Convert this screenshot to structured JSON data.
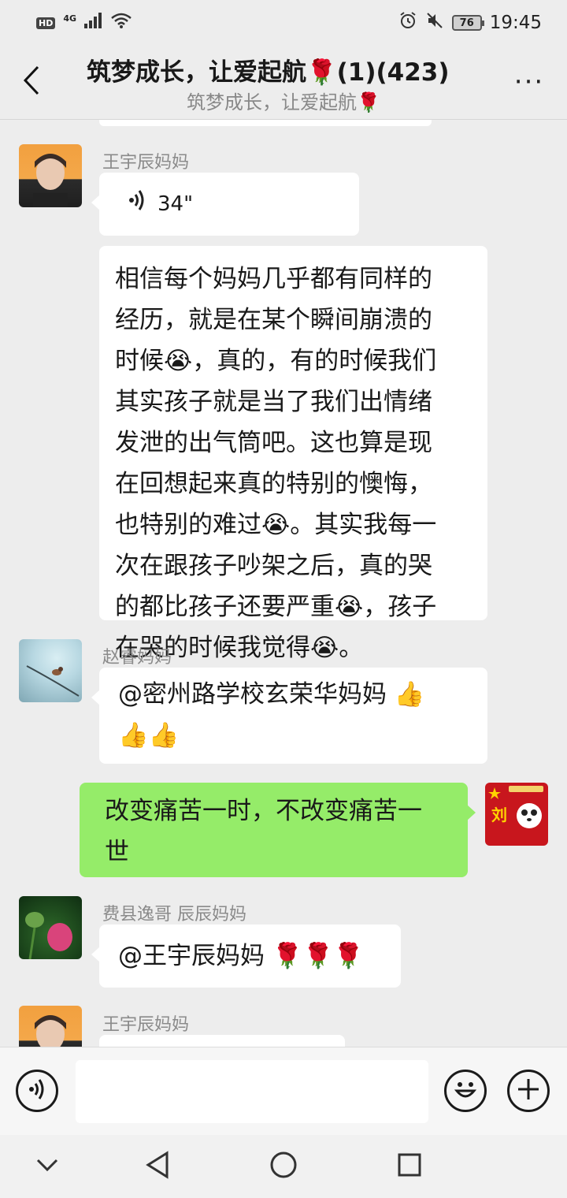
{
  "status_bar": {
    "hd": "HD",
    "network": "4G",
    "battery": "76",
    "time": "19:45"
  },
  "header": {
    "title": "筑梦成长，让爱起航🌹(1)(423)",
    "subtitle": "筑梦成长，让爱起航🌹",
    "more": "···"
  },
  "messages": [
    {
      "sender": "王宇辰妈妈",
      "type": "voice",
      "duration": "34\""
    },
    {
      "sender": "王宇辰妈妈",
      "type": "text",
      "lines": [
        "相信每个妈妈几乎都有同样的",
        "经历，就是在某个瞬间崩溃的",
        "时候😭，真的，有的时候我们",
        "其实孩子就是当了我们出情绪",
        "发泄的出气筒吧。这也算是现",
        "在回想起来真的特别的懊悔，",
        "也特别的难过😭。其实我每一",
        "次在跟孩子吵架之后，真的哭",
        "的都比孩子还要严重😭，孩子",
        "在哭的时候我觉得😭。"
      ]
    },
    {
      "sender": "赵睿妈妈",
      "type": "text",
      "lines": [
        "@密州路学校玄荣华妈妈 👍",
        "👍👍"
      ]
    },
    {
      "sender": "me",
      "type": "text",
      "lines": [
        "改变痛苦一时，不改变痛苦一",
        "世"
      ]
    },
    {
      "sender": "费县逸哥  辰辰妈妈",
      "type": "text",
      "lines": [
        "@王宇辰妈妈 🌹🌹🌹"
      ]
    },
    {
      "sender": "王宇辰妈妈",
      "type": "partial"
    }
  ],
  "my_avatar_text": "刘",
  "input_bar": {
    "placeholder": ""
  },
  "icons": {
    "back": "back-chevron-icon",
    "voice_input": "voice-input-icon",
    "emoji": "emoji-icon",
    "add": "plus-icon",
    "nav_down": "chevron-down-icon",
    "nav_back": "triangle-back-icon",
    "nav_home": "circle-home-icon",
    "nav_recent": "square-recent-icon"
  },
  "colors": {
    "chat_bg": "#ededed",
    "my_bubble": "#95ec69",
    "other_bubble": "#ffffff",
    "sender_name": "#8a8a8a"
  }
}
